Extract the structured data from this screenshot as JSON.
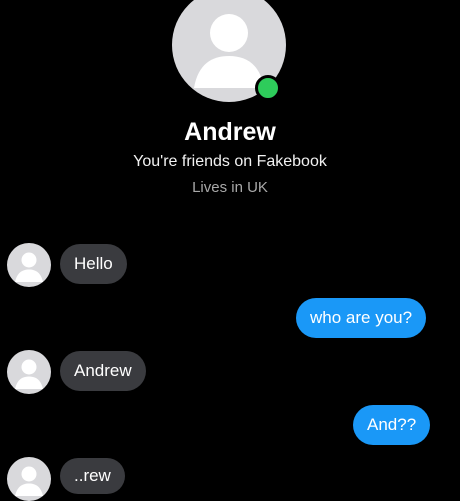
{
  "profile": {
    "name": "Andrew",
    "relationship": "You're friends on Fakebook",
    "location": "Lives in UK",
    "online_color": "#2ecc5b"
  },
  "messages": [
    {
      "from": "them",
      "text": "Hello"
    },
    {
      "from": "me",
      "text": "who are you?"
    },
    {
      "from": "them",
      "text": "Andrew"
    },
    {
      "from": "me",
      "text": "And??"
    },
    {
      "from": "them",
      "text": "..rew"
    }
  ],
  "colors": {
    "background": "#000000",
    "incoming_bubble": "#3a3b3f",
    "outgoing_bubble": "#1a98f7"
  },
  "icons": {
    "profile_avatar": "default-person-avatar-icon",
    "online_indicator": "online-status-dot"
  }
}
